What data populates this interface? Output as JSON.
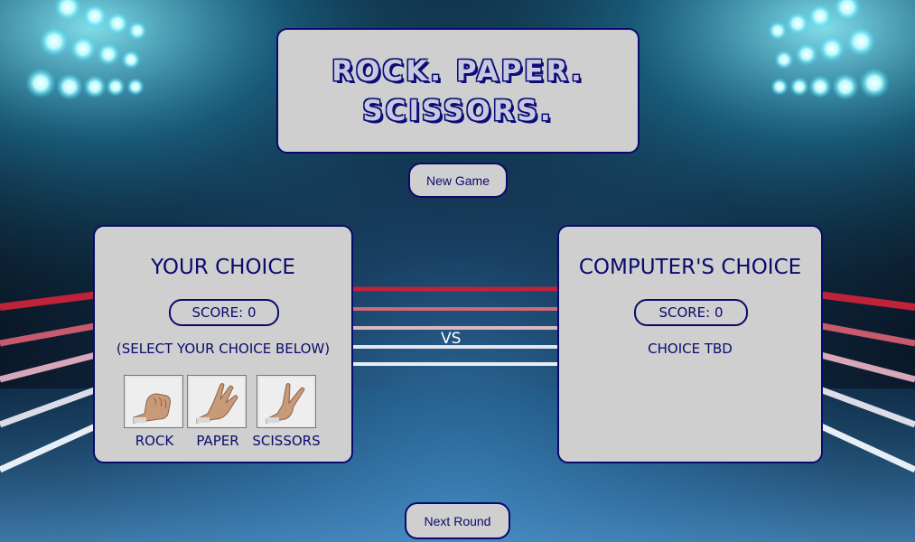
{
  "title": {
    "line1": "ROCK. PAPER.",
    "line2": "SCISSORS."
  },
  "new_game_label": "New Game",
  "next_round_label": "Next Round",
  "vs_label": "VS",
  "player": {
    "title": "YOUR CHOICE",
    "score": "SCORE: 0",
    "hint": "(SELECT YOUR CHOICE BELOW)",
    "choices": [
      {
        "label": "ROCK",
        "icon": "rock-hand-icon"
      },
      {
        "label": "PAPER",
        "icon": "paper-hand-icon"
      },
      {
        "label": "SCISSORS",
        "icon": "scissors-hand-icon"
      }
    ]
  },
  "computer": {
    "title": "COMPUTER'S CHOICE",
    "score": "SCORE: 0",
    "choice": "CHOICE TBD"
  },
  "colors": {
    "accent": "#0a0a6e",
    "panel": "#cfcfcf",
    "light": "#3de0ff"
  }
}
